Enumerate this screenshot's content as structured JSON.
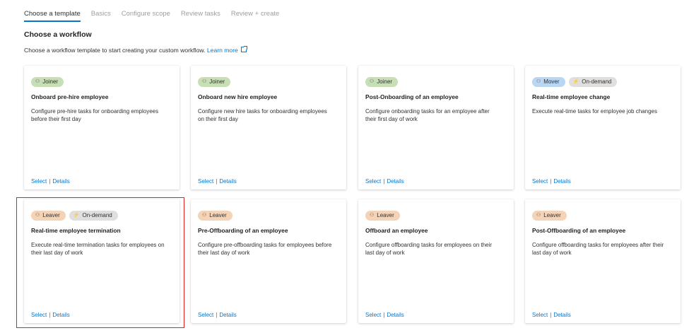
{
  "tabs": [
    "Choose a template",
    "Basics",
    "Configure scope",
    "Review tasks",
    "Review + create"
  ],
  "heading": "Choose a workflow",
  "description": "Choose a workflow template to start creating your custom workflow.",
  "learn_more": "Learn more",
  "colors": {
    "joiner": "#c7dfb5",
    "leaver": "#f5d3b6",
    "mover": "#b8d7f3",
    "on_demand": "#e1dfdd",
    "link": "#0078d4",
    "highlight": "#e02020"
  },
  "cards": [
    {
      "badges": [
        "Joiner"
      ],
      "title": "Onboard pre-hire employee",
      "desc": "Configure pre-hire tasks for onboarding employees before their first day",
      "select": "Select",
      "details": "Details"
    },
    {
      "badges": [
        "Joiner"
      ],
      "title": "Onboard new hire employee",
      "desc": "Configure new hire tasks for onboarding employees on their first day",
      "select": "Select",
      "details": "Details"
    },
    {
      "badges": [
        "Joiner"
      ],
      "title": "Post-Onboarding of an employee",
      "desc": "Configure onboarding tasks for an employee after their first day of work",
      "select": "Select",
      "details": "Details"
    },
    {
      "badges": [
        "Mover",
        "On-demand"
      ],
      "title": "Real-time employee change",
      "desc": "Execute real-time tasks for employee job changes",
      "select": "Select",
      "details": "Details"
    },
    {
      "badges": [
        "Leaver",
        "On-demand"
      ],
      "title": "Real-time employee termination",
      "desc": "Execute real-time termination tasks for employees on their last day of work",
      "select": "Select",
      "details": "Details"
    },
    {
      "badges": [
        "Leaver"
      ],
      "title": "Pre-Offboarding of an employee",
      "desc": "Configure pre-offboarding tasks for employees before their last day of work",
      "select": "Select",
      "details": "Details"
    },
    {
      "badges": [
        "Leaver"
      ],
      "title": "Offboard an employee",
      "desc": "Configure offboarding tasks for employees on their last day of work",
      "select": "Select",
      "details": "Details"
    },
    {
      "badges": [
        "Leaver"
      ],
      "title": "Post-Offboarding of an employee",
      "desc": "Configure offboarding tasks for employees after their last day of work",
      "select": "Select",
      "details": "Details"
    }
  ]
}
